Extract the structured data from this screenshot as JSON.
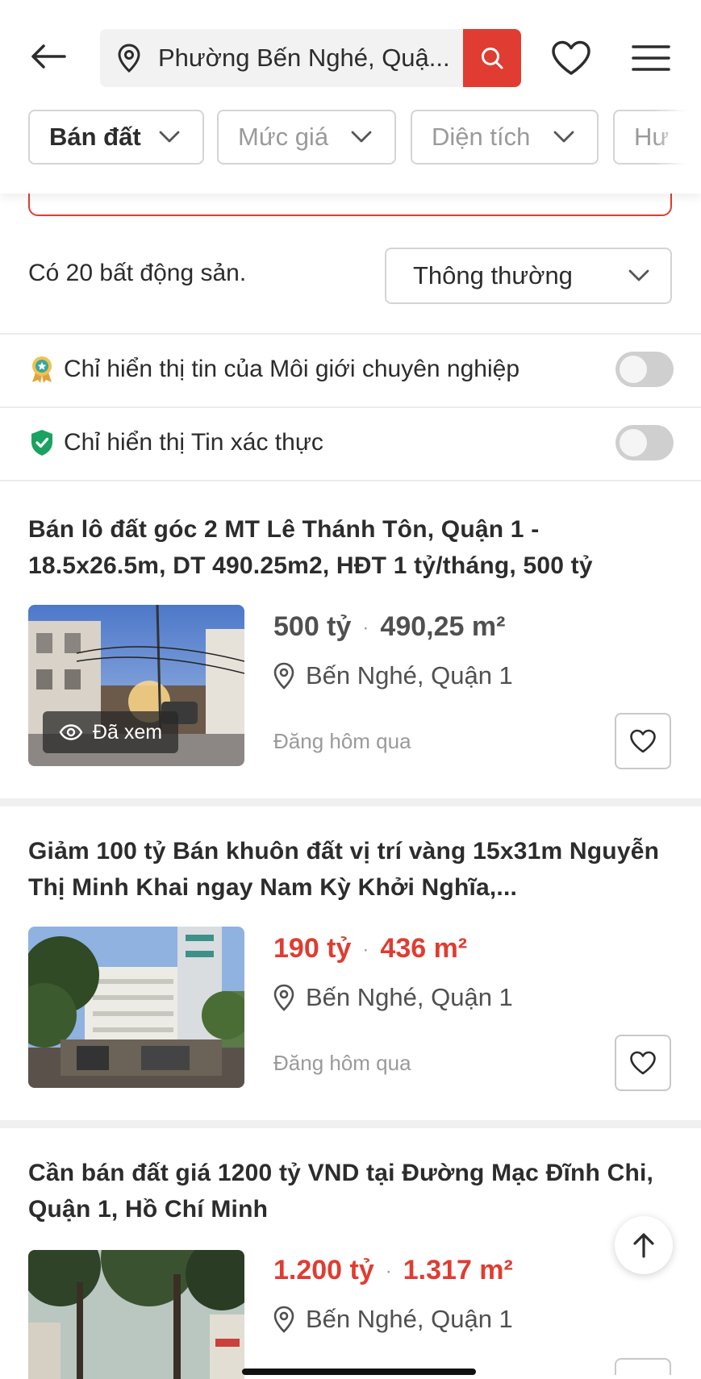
{
  "header": {
    "search_text": "Phường Bến Nghé, Quậ...",
    "icons": [
      "back-arrow-icon",
      "location-pin-icon",
      "search-icon",
      "heart-icon",
      "hamburger-menu-icon"
    ]
  },
  "filters": [
    {
      "label": "Bán đất",
      "active": true
    },
    {
      "label": "Mức giá",
      "active": false
    },
    {
      "label": "Diện tích",
      "active": false
    },
    {
      "label": "Hư",
      "active": false
    }
  ],
  "results": {
    "count_text": "Có 20 bất động sản.",
    "sort_label": "Thông thường"
  },
  "toggles": [
    {
      "label": "Chỉ hiển thị tin của Môi giới chuyên nghiệp",
      "icon": "pro-broker-badge-icon",
      "on": false
    },
    {
      "label": "Chỉ hiển thị Tin xác thực",
      "icon": "verified-shield-icon",
      "on": false
    }
  ],
  "listings": [
    {
      "title": "Bán lô đất góc 2 MT Lê Thánh Tôn, Quận 1 - 18.5x26.5m, DT 490.25m2, HĐT 1 tỷ/tháng, 500 tỷ",
      "price": "500 tỷ",
      "area": "490,25 m²",
      "location": "Bến Nghé, Quận 1",
      "posted": "Đăng hôm qua",
      "seen_label": "Đã xem",
      "highlight": false
    },
    {
      "title": "Giảm 100 tỷ Bán khuôn đất vị trí vàng 15x31m Nguyễn Thị Minh Khai ngay Nam Kỳ Khởi Nghĩa,...",
      "price": "190 tỷ",
      "area": "436 m²",
      "location": "Bến Nghé, Quận 1",
      "posted": "Đăng hôm qua",
      "highlight": true
    },
    {
      "title": "Cần bán đất giá 1200 tỷ VND tại Đường Mạc Đĩnh Chi, Quận 1, Hồ Chí Minh",
      "price": "1.200 tỷ",
      "area": "1.317 m²",
      "location": "Bến Nghé, Quận 1",
      "highlight": true
    }
  ],
  "colors": {
    "accent": "#e03c31",
    "text": "#2c2c2c",
    "muted": "#9a9a9a",
    "border": "#d4d4d4"
  }
}
